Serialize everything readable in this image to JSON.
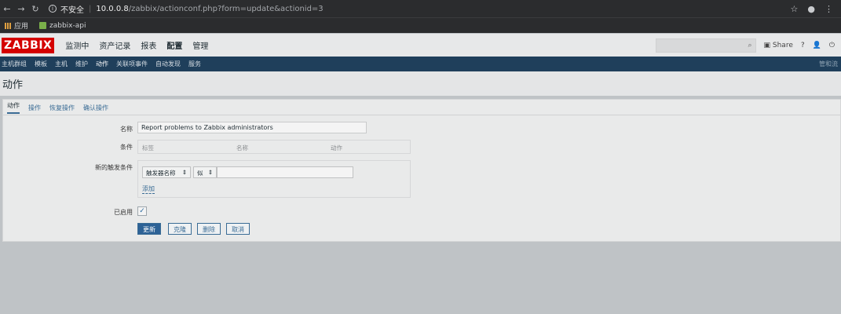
{
  "browser": {
    "url_prefix": "不安全",
    "url_host": "10.0.0.8",
    "url_path": "/zabbix/actionconf.php?form=update&actionid=3",
    "bookmarks": [
      {
        "label": "应用"
      },
      {
        "label": "zabbix-api"
      }
    ]
  },
  "topnav": {
    "logo": "ZABBIX",
    "items": [
      "监测中",
      "资产记录",
      "报表",
      "配置",
      "管理"
    ],
    "active_index": 3,
    "share_label": "Share",
    "help_label": "?"
  },
  "subnav": {
    "items": [
      "主机群组",
      "模板",
      "主机",
      "维护",
      "动作",
      "关联项事件",
      "自动发现",
      "服务"
    ],
    "active_index": 4,
    "right_label": "管和流"
  },
  "page": {
    "title": "动作"
  },
  "tabs": [
    "动作",
    "操作",
    "恢复操作",
    "确认操作"
  ],
  "form": {
    "name_label": "名称",
    "name_value": "Report problems to Zabbix administrators",
    "conditions_label": "条件",
    "conditions_headers": [
      "标签",
      "名称",
      "动作"
    ],
    "new_condition_label": "新的触发条件",
    "condition_type": "触发器名称",
    "condition_operator": "似",
    "condition_value": "",
    "add_label": "添加",
    "enabled_label": "已启用",
    "enabled_mark": "✓"
  },
  "buttons": {
    "update": "更新",
    "clone": "克隆",
    "delete": "删除",
    "cancel": "取消"
  }
}
